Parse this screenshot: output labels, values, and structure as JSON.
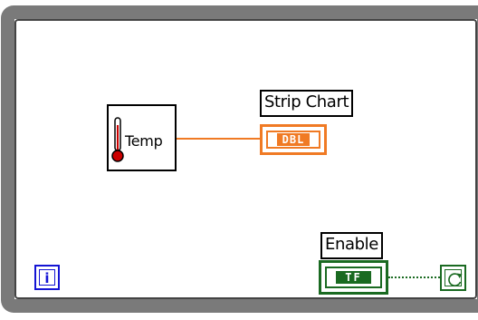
{
  "diagram": {
    "temp_node": {
      "label": "Temp",
      "icon": "thermometer-icon"
    },
    "strip_chart": {
      "label": "Strip Chart",
      "terminal_type": "DBL"
    },
    "enable": {
      "label": "Enable",
      "terminal_type": "TF"
    },
    "iteration_terminal": {
      "text": "i"
    },
    "conditional_terminal": {
      "icon": "loop-condition-icon"
    }
  },
  "colors": {
    "loop_border": "#7a7a7a",
    "numeric_wire": "#f07a24",
    "boolean_wire": "#1a6a21",
    "iteration_blue": "#1414d4",
    "thermometer_red": "#cc0000"
  }
}
